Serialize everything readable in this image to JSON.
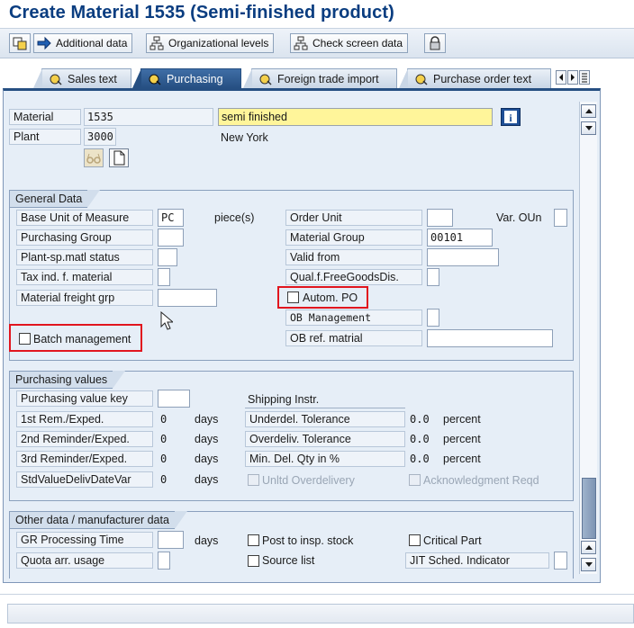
{
  "window": {
    "title": "Create Material 1535 (Semi-finished product)"
  },
  "toolbar": {
    "additional_data": "Additional data",
    "org_levels": "Organizational levels",
    "check_screen": "Check screen data"
  },
  "tabs": [
    {
      "label": "Sales text"
    },
    {
      "label": "Purchasing",
      "active": true
    },
    {
      "label": "Foreign trade import"
    },
    {
      "label": "Purchase order text"
    }
  ],
  "header": {
    "material_label": "Material",
    "material_value": "1535",
    "description": "semi finished",
    "plant_label": "Plant",
    "plant_value": "3000",
    "plant_name": "New York"
  },
  "general_data": {
    "title": "General Data",
    "base_uom_label": "Base Unit of Measure",
    "base_uom_value": "PC",
    "base_uom_text": "piece(s)",
    "order_unit_label": "Order Unit",
    "var_oun_label": "Var. OUn",
    "purchasing_group_label": "Purchasing Group",
    "material_group_label": "Material Group",
    "material_group_value": "00101",
    "plant_sp_status_label": "Plant-sp.matl status",
    "valid_from_label": "Valid from",
    "tax_ind_label": "Tax ind. f. material",
    "qual_free_goods_label": "Qual.f.FreeGoodsDis.",
    "freight_grp_label": "Material freight grp",
    "autom_po_label": "Autom. PO",
    "ob_management_label": "OB Management",
    "batch_mgmt_label": "Batch management",
    "ob_ref_label": "OB ref. matrial"
  },
  "purchasing_values": {
    "title": "Purchasing values",
    "value_key_label": "Purchasing value key",
    "shipping_instr_label": "Shipping Instr.",
    "rem1_label": "1st Rem./Exped.",
    "rem1_value": "0",
    "rem2_label": "2nd Reminder/Exped.",
    "rem2_value": "0",
    "rem3_label": "3rd Reminder/Exped.",
    "rem3_value": "0",
    "stdvalue_label": "StdValueDelivDateVar",
    "stdvalue_value": "0",
    "days": "days",
    "underdel_label": "Underdel. Tolerance",
    "underdel_value": "0.0",
    "overdeliv_label": "Overdeliv. Tolerance",
    "overdeliv_value": "0.0",
    "min_del_label": "Min. Del. Qty in %",
    "min_del_value": "0.0",
    "percent": "percent",
    "unltd_label": "Unltd Overdelivery",
    "ack_label": "Acknowledgment Reqd"
  },
  "other_data": {
    "title": "Other data / manufacturer data",
    "gr_time_label": "GR Processing Time",
    "days": "days",
    "post_insp_label": "Post to insp. stock",
    "critical_part_label": "Critical Part",
    "quota_label": "Quota arr. usage",
    "source_list_label": "Source list",
    "jit_label": "JIT Sched. Indicator"
  },
  "colors": {
    "title": "#0a3d80",
    "active_tab": "#264f82",
    "highlight_box": "#e1151e",
    "description_field": "#fff59a"
  }
}
